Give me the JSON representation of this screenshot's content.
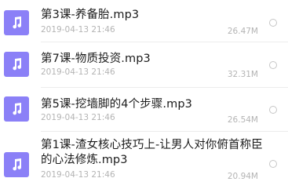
{
  "files": [
    {
      "icon": "music-note-icon",
      "name": "第3课-养备胎.mp3",
      "date": "2019-04-13 21:46",
      "size": "26.47M",
      "selected": false
    },
    {
      "icon": "music-note-icon",
      "name": "第7课-物质投资.mp3",
      "date": "2019-04-13 21:46",
      "size": "32.31M",
      "selected": false
    },
    {
      "icon": "music-note-icon",
      "name": "第5课-挖墙脚的4个步骤.mp3",
      "date": "2019-04-13 21:46",
      "size": "26.54M",
      "selected": false
    },
    {
      "icon": "music-note-icon",
      "name": "第1课-渣女核心技巧上-让男人对你俯首称臣的心法修炼.mp3",
      "date": "2019-04-13 21:46",
      "size": "20.94M",
      "selected": false
    }
  ],
  "colors": {
    "icon_background": "#8b80f7",
    "name_text": "#1c1c1c",
    "meta_text": "#b4b4b4",
    "radio_border": "#c6c6c6"
  }
}
